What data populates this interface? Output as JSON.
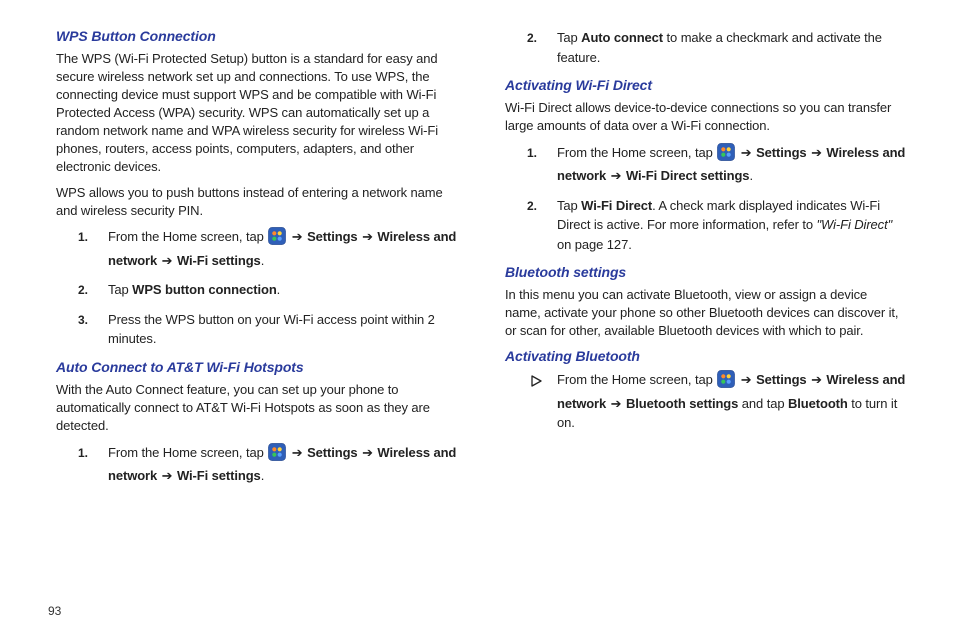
{
  "pageNumber": "93",
  "arrow": "➔",
  "left": {
    "sec1": {
      "title": "WPS Button Connection",
      "p1": "The WPS (Wi-Fi Protected Setup) button is a standard for easy and secure wireless network set up and connections. To use WPS, the connecting device must support WPS and be compatible with Wi-Fi Protected Access (WPA) security. WPS can automatically set up a random network name and WPA wireless security for wireless Wi-Fi phones, routers, access points, computers, adapters, and other electronic devices.",
      "p2": "WPS allows you to push buttons instead of entering a network name and wireless security PIN.",
      "step1_a": "From the Home screen, tap ",
      "step1_b": " Settings ",
      "step1_c": " Wireless and network ",
      "step1_d": " Wi-Fi settings",
      "step2_a": "Tap ",
      "step2_b": "WPS button connection",
      "step3": "Press the WPS button on your Wi-Fi access point within 2 minutes."
    },
    "sec2": {
      "title": "Auto Connect to AT&T Wi-Fi Hotspots",
      "p1": "With the Auto Connect feature, you can set up your phone to automatically connect to AT&T Wi-Fi Hotspots as soon as they are detected.",
      "step1_a": "From the Home screen, tap ",
      "step1_b": " Settings ",
      "step1_c": " Wireless and network ",
      "step1_d": " Wi-Fi settings"
    }
  },
  "right": {
    "contStep2_a": "Tap ",
    "contStep2_b": "Auto connect",
    "contStep2_c": " to make a checkmark and activate the feature.",
    "sec1": {
      "title": "Activating Wi-Fi Direct",
      "p1": "Wi-Fi Direct allows device-to-device connections so you can transfer large amounts of data over a Wi-Fi connection.",
      "step1_a": "From the Home screen, tap ",
      "step1_b": " Settings ",
      "step1_c": " Wireless and network ",
      "step1_d": " Wi-Fi Direct settings",
      "step2_a": "Tap ",
      "step2_b": "Wi-Fi Direct",
      "step2_c": ". A check mark displayed indicates Wi-Fi Direct is active. For more information, refer to ",
      "step2_d": "\"Wi-Fi Direct\"",
      "step2_e": " on page 127."
    },
    "sec2": {
      "title": "Bluetooth settings",
      "p1": "In this menu you can activate Bluetooth, view or assign a device name, activate your phone so other Bluetooth devices can discover it, or scan for other, available Bluetooth devices with which to pair."
    },
    "sec3": {
      "title": "Activating Bluetooth",
      "step_a": "From the Home screen, tap ",
      "step_b": " Settings ",
      "step_c": " Wireless and network ",
      "step_d": " Bluetooth settings",
      "step_e": " and tap ",
      "step_f": "Bluetooth",
      "step_g": " to turn it on."
    }
  }
}
